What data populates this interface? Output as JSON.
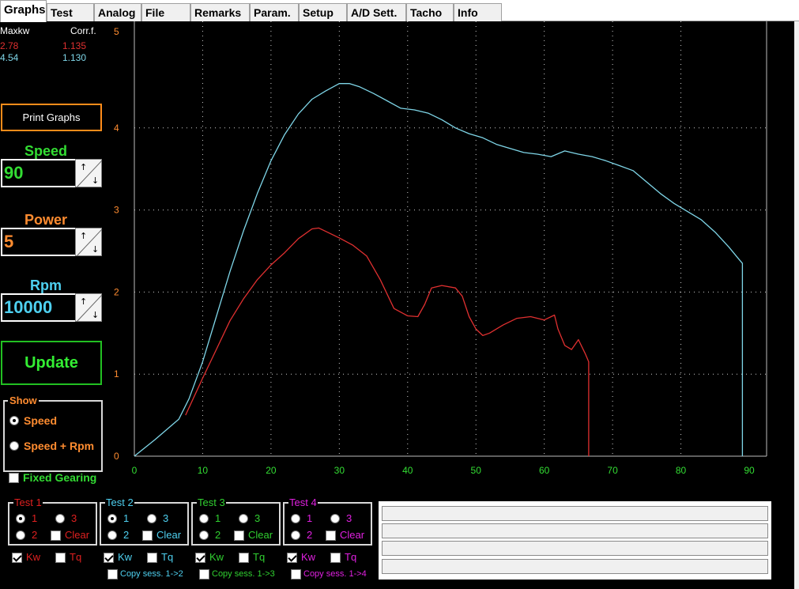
{
  "tabs": [
    {
      "label": "Graphs",
      "active": true
    },
    {
      "label": "Test"
    },
    {
      "label": "Analog"
    },
    {
      "label": "File"
    },
    {
      "label": "Remarks"
    },
    {
      "label": "Param."
    },
    {
      "label": "Setup"
    },
    {
      "label": "A/D Sett."
    },
    {
      "label": "Tacho"
    },
    {
      "label": "Info"
    }
  ],
  "summary": {
    "header_max": "Maxkw",
    "header_corr": "Corr.f.",
    "rows": [
      {
        "max": "2.78",
        "corr": "1.135",
        "color": "#e03030"
      },
      {
        "max": "4.54",
        "corr": "1.130",
        "color": "#7fd6e8"
      }
    ]
  },
  "print_button": "Print Graphs",
  "speed": {
    "label": "Speed",
    "value": "90",
    "color": "#33dd33"
  },
  "power": {
    "label": "Power",
    "value": "5",
    "color": "#ff8c30"
  },
  "rpm": {
    "label": "Rpm",
    "value": "10000",
    "color": "#4ed0f0"
  },
  "update_button": "Update",
  "show": {
    "title": "Show",
    "options": [
      "Speed",
      "Speed + Rpm"
    ],
    "selected": "Speed"
  },
  "fixed_gearing": {
    "label": "Fixed Gearing",
    "checked": false
  },
  "test_groups": [
    {
      "title": "Test 1",
      "color": "#e02020",
      "opt1": "1",
      "opt2": "2",
      "opt3": "3",
      "selected": "1",
      "clear": "Clear",
      "kw": "Kw",
      "tq": "Tq",
      "kw_checked": true,
      "tq_checked": false,
      "copy": ""
    },
    {
      "title": "Test 2",
      "color": "#4ed0f0",
      "opt1": "1",
      "opt2": "2",
      "opt3": "3",
      "selected": "1",
      "clear": "Clear",
      "kw": "Kw",
      "tq": "Tq",
      "kw_checked": true,
      "tq_checked": false,
      "copy": "Copy sess. 1->2"
    },
    {
      "title": "Test 3",
      "color": "#30d030",
      "opt1": "1",
      "opt2": "2",
      "opt3": "3",
      "selected": "",
      "clear": "Clear",
      "kw": "Kw",
      "tq": "Tq",
      "kw_checked": true,
      "tq_checked": false,
      "copy": "Copy sess. 1->3"
    },
    {
      "title": "Test 4",
      "color": "#e020e0",
      "opt1": "1",
      "opt2": "2",
      "opt3": "3",
      "selected": "",
      "clear": "Clear",
      "kw": "Kw",
      "tq": "Tq",
      "kw_checked": true,
      "tq_checked": false,
      "copy": "Copy sess. 1->4"
    }
  ],
  "chart_data": {
    "type": "line",
    "xlim": [
      0,
      90
    ],
    "ylim": [
      0,
      5
    ],
    "xticks": [
      0,
      10,
      20,
      30,
      40,
      50,
      60,
      70,
      80,
      90
    ],
    "yticks": [
      0,
      1,
      2,
      3,
      4,
      5
    ],
    "grid": true,
    "x_tick_color": "#33dd33",
    "y_tick_color": "#ff8c30",
    "series": [
      {
        "color": "#7fd6e8",
        "end_drop_to_zero": true,
        "points": [
          [
            0,
            0
          ],
          [
            3,
            0.2
          ],
          [
            6.5,
            0.45
          ],
          [
            8,
            0.7
          ],
          [
            10,
            1.15
          ],
          [
            12,
            1.7
          ],
          [
            14,
            2.25
          ],
          [
            16,
            2.75
          ],
          [
            18,
            3.2
          ],
          [
            20,
            3.6
          ],
          [
            22,
            3.92
          ],
          [
            24,
            4.17
          ],
          [
            26,
            4.35
          ],
          [
            28,
            4.45
          ],
          [
            30,
            4.54
          ],
          [
            31.5,
            4.54
          ],
          [
            33,
            4.5
          ],
          [
            35,
            4.42
          ],
          [
            37,
            4.33
          ],
          [
            39,
            4.24
          ],
          [
            41,
            4.22
          ],
          [
            43,
            4.18
          ],
          [
            45,
            4.1
          ],
          [
            47,
            4.0
          ],
          [
            49,
            3.93
          ],
          [
            51,
            3.88
          ],
          [
            53,
            3.8
          ],
          [
            55,
            3.75
          ],
          [
            57,
            3.7
          ],
          [
            59,
            3.68
          ],
          [
            61,
            3.65
          ],
          [
            63,
            3.72
          ],
          [
            65,
            3.68
          ],
          [
            67,
            3.65
          ],
          [
            69,
            3.6
          ],
          [
            71,
            3.54
          ],
          [
            73,
            3.48
          ],
          [
            75,
            3.34
          ],
          [
            77,
            3.2
          ],
          [
            79,
            3.08
          ],
          [
            81,
            2.98
          ],
          [
            83,
            2.88
          ],
          [
            85,
            2.73
          ],
          [
            87,
            2.55
          ],
          [
            88.5,
            2.4
          ],
          [
            89,
            2.35
          ]
        ]
      },
      {
        "color": "#e03030",
        "end_drop_to_zero": true,
        "points": [
          [
            7.5,
            0.5
          ],
          [
            10,
            0.95
          ],
          [
            12,
            1.3
          ],
          [
            14,
            1.65
          ],
          [
            16,
            1.92
          ],
          [
            18,
            2.15
          ],
          [
            20,
            2.33
          ],
          [
            22,
            2.48
          ],
          [
            24,
            2.65
          ],
          [
            26,
            2.77
          ],
          [
            27,
            2.78
          ],
          [
            28,
            2.74
          ],
          [
            30,
            2.66
          ],
          [
            32,
            2.57
          ],
          [
            34,
            2.44
          ],
          [
            36,
            2.15
          ],
          [
            38,
            1.8
          ],
          [
            40,
            1.71
          ],
          [
            41.5,
            1.7
          ],
          [
            42.5,
            1.85
          ],
          [
            43.5,
            2.05
          ],
          [
            45,
            2.08
          ],
          [
            47,
            2.05
          ],
          [
            48,
            1.95
          ],
          [
            49,
            1.7
          ],
          [
            50,
            1.55
          ],
          [
            51,
            1.47
          ],
          [
            52,
            1.5
          ],
          [
            54,
            1.6
          ],
          [
            56,
            1.68
          ],
          [
            58,
            1.7
          ],
          [
            60,
            1.66
          ],
          [
            61.5,
            1.72
          ],
          [
            62,
            1.55
          ],
          [
            63,
            1.35
          ],
          [
            64,
            1.3
          ],
          [
            65,
            1.42
          ],
          [
            66,
            1.25
          ],
          [
            66.5,
            1.15
          ]
        ]
      }
    ]
  }
}
